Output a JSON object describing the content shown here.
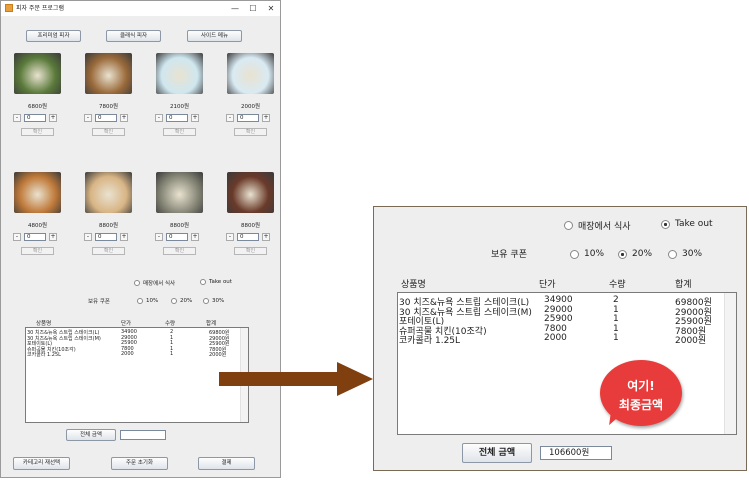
{
  "window": {
    "title": "피자 주문 프로그램",
    "minimize": "—",
    "maximize": "☐",
    "close": "✕"
  },
  "category_tabs": [
    "프리미엄 피자",
    "클래식 피자",
    "사이드 메뉴"
  ],
  "menu_items": [
    {
      "price": "6800원",
      "qty": "0",
      "confirm": "확인",
      "icon": "salad-image",
      "color": "#5a7a3a"
    },
    {
      "price": "7800원",
      "qty": "0",
      "confirm": "확인",
      "icon": "fried-chicken-image",
      "color": "#9a6a3a"
    },
    {
      "price": "2100원",
      "qty": "0",
      "confirm": "확인",
      "icon": "sprite-bottle-image",
      "color": "#cfe7f0"
    },
    {
      "price": "2000원",
      "qty": "0",
      "confirm": "확인",
      "icon": "cola-bottle-image",
      "color": "#d9eaf3"
    },
    {
      "price": "4800원",
      "qty": "0",
      "confirm": "확인",
      "icon": "chicken-bites-image",
      "color": "#c07a3a"
    },
    {
      "price": "8800원",
      "qty": "0",
      "confirm": "확인",
      "icon": "pasta-image",
      "color": "#d8b585"
    },
    {
      "price": "8800원",
      "qty": "0",
      "confirm": "확인",
      "icon": "cream-pasta-image",
      "color": "#8a8a7a"
    },
    {
      "price": "8800원",
      "qty": "0",
      "confirm": "확인",
      "icon": "pan-pasta-image",
      "color": "#6a3a2a"
    }
  ],
  "stepper": {
    "minus": "-",
    "plus": "+"
  },
  "dining": {
    "dine_in": "매장에서 식사",
    "take_out": "Take out",
    "selected": "take_out"
  },
  "coupon": {
    "label": "보유 쿠폰",
    "options": [
      "10%",
      "20%",
      "30%"
    ],
    "selected": "20%"
  },
  "order_table": {
    "headers": [
      "상품명",
      "단가",
      "수량",
      "합계"
    ],
    "rows": [
      [
        "30 치즈&뉴욕 스트립 스테이크(L)",
        "34900",
        "2",
        "69800원"
      ],
      [
        "30 치즈&뉴욕 스트립 스테이크(M)",
        "29000",
        "1",
        "29000원"
      ],
      [
        "포테이토(L)",
        "25900",
        "1",
        "25900원"
      ],
      [
        "슈퍼곡물 치킨(10조각)",
        "7800",
        "1",
        "7800원"
      ],
      [
        "코카콜라 1.25L",
        "2000",
        "1",
        "2000원"
      ]
    ]
  },
  "total": {
    "button": "전체 금액",
    "value": "106600원"
  },
  "footer_buttons": [
    "카테고리 재선택",
    "주문 초기화",
    "결제"
  ],
  "callout": {
    "line1": "여기!",
    "line2": "최종금액"
  },
  "colors": {
    "arrow": "#7f3f0f",
    "bubble": "#e83b3b"
  }
}
